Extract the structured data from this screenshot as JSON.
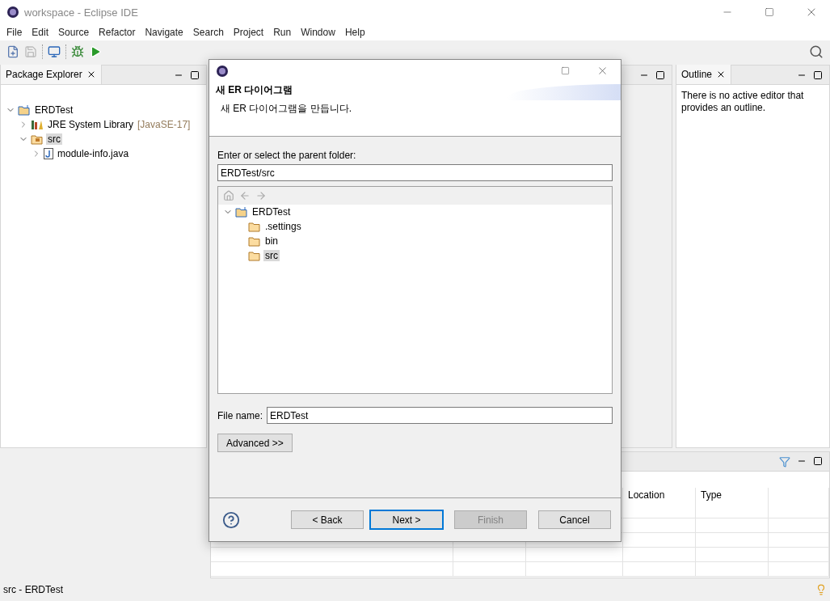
{
  "window": {
    "title": "workspace - Eclipse IDE"
  },
  "menu": [
    "File",
    "Edit",
    "Source",
    "Refactor",
    "Navigate",
    "Search",
    "Project",
    "Run",
    "Window",
    "Help"
  ],
  "package_explorer": {
    "tab": "Package Explorer",
    "tree": [
      {
        "label": "ERDTest",
        "kind": "project",
        "expanded": true,
        "selected": false,
        "children": [
          {
            "label": "JRE System Library",
            "decoration": "[JavaSE-17]",
            "kind": "library",
            "expanded": false,
            "selected": false
          },
          {
            "label": "src",
            "kind": "package-folder",
            "expanded": true,
            "selected": true,
            "children": [
              {
                "label": "module-info.java",
                "kind": "java-file",
                "expanded": false,
                "selected": false
              }
            ]
          }
        ]
      }
    ]
  },
  "outline": {
    "tab": "Outline",
    "message": "There is no active editor that provides an outline."
  },
  "bottom_panel": {
    "columns": [
      "Location",
      "Type"
    ]
  },
  "status_bar": {
    "text": "src - ERDTest"
  },
  "dialog": {
    "title": "새 ER 다이어그램",
    "description": "새 ER 다이어그램을 만듭니다.",
    "parent_folder_label": "Enter or select the parent folder:",
    "parent_folder_value": "ERDTest/src",
    "folder_tree": [
      {
        "label": "ERDTest",
        "kind": "project",
        "expanded": true,
        "selected": false,
        "children": [
          {
            "label": ".settings",
            "kind": "folder",
            "selected": false
          },
          {
            "label": "bin",
            "kind": "folder",
            "selected": false
          },
          {
            "label": "src",
            "kind": "folder",
            "selected": true
          }
        ]
      }
    ],
    "file_name_label": "File name:",
    "file_name_value": "ERDTest",
    "advanced_button": "Advanced >>",
    "buttons": [
      {
        "label": "< Back",
        "kind": "back",
        "disabled": false,
        "default": false
      },
      {
        "label": "Next >",
        "kind": "next",
        "disabled": false,
        "default": true
      },
      {
        "label": "Finish",
        "kind": "finish",
        "disabled": true,
        "default": false
      },
      {
        "label": "Cancel",
        "kind": "cancel",
        "disabled": false,
        "default": false
      }
    ]
  }
}
